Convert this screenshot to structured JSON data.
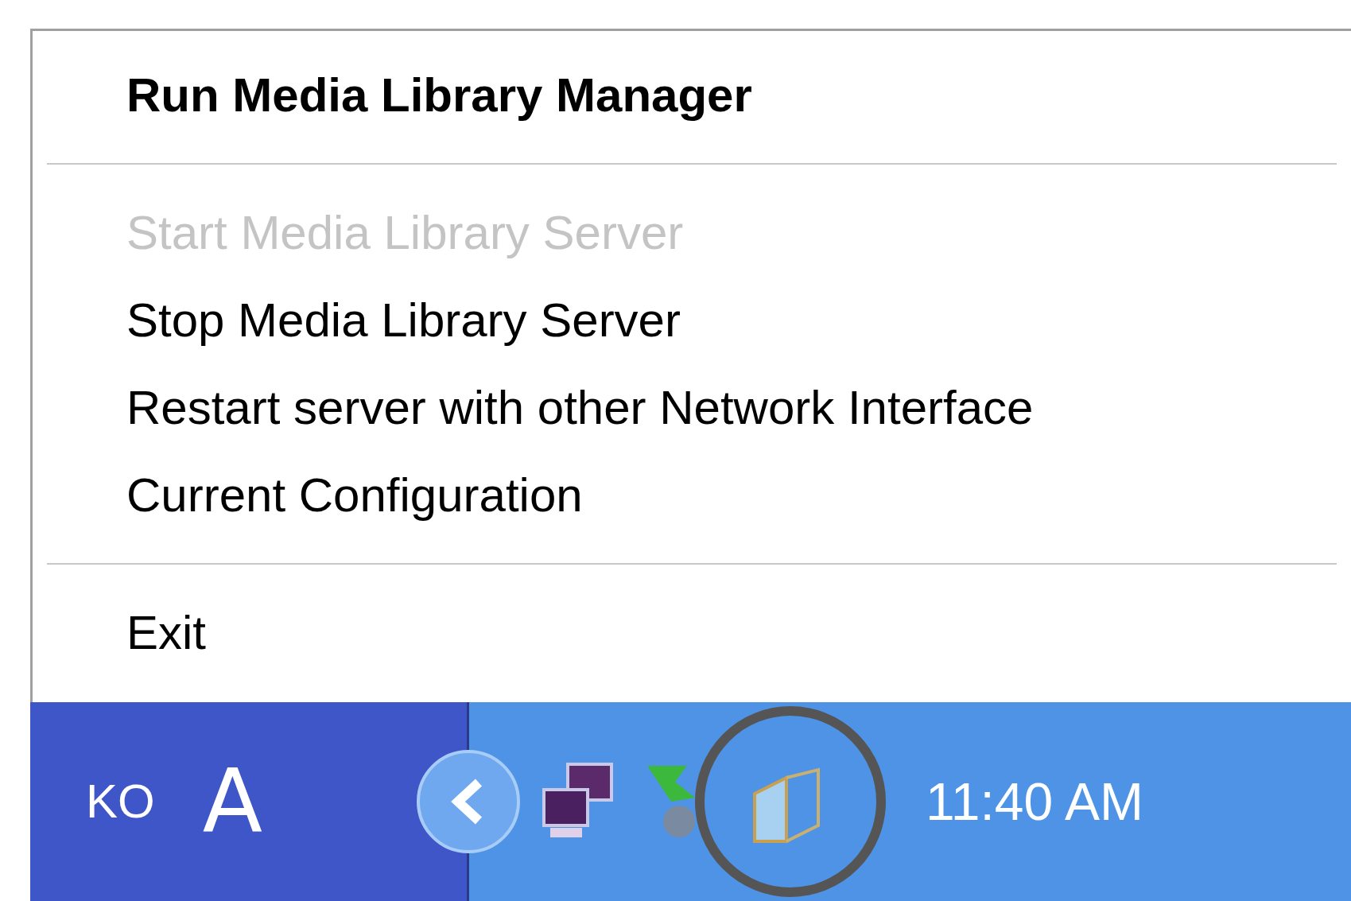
{
  "menu": {
    "items": [
      {
        "kind": "default",
        "label": "Run Media Library Manager",
        "disabled": false
      },
      {
        "kind": "separator"
      },
      {
        "kind": "item",
        "label": "Start Media Library Server",
        "disabled": true
      },
      {
        "kind": "item",
        "label": "Stop Media Library Server",
        "disabled": false
      },
      {
        "kind": "item",
        "label": "Restart server with other Network Interface",
        "disabled": false
      },
      {
        "kind": "item",
        "label": "Current Configuration",
        "disabled": false
      },
      {
        "kind": "separator"
      },
      {
        "kind": "item",
        "label": "Exit",
        "disabled": false
      }
    ]
  },
  "taskbar": {
    "language": "KO",
    "ime": "A",
    "clock": "11:40 AM"
  }
}
